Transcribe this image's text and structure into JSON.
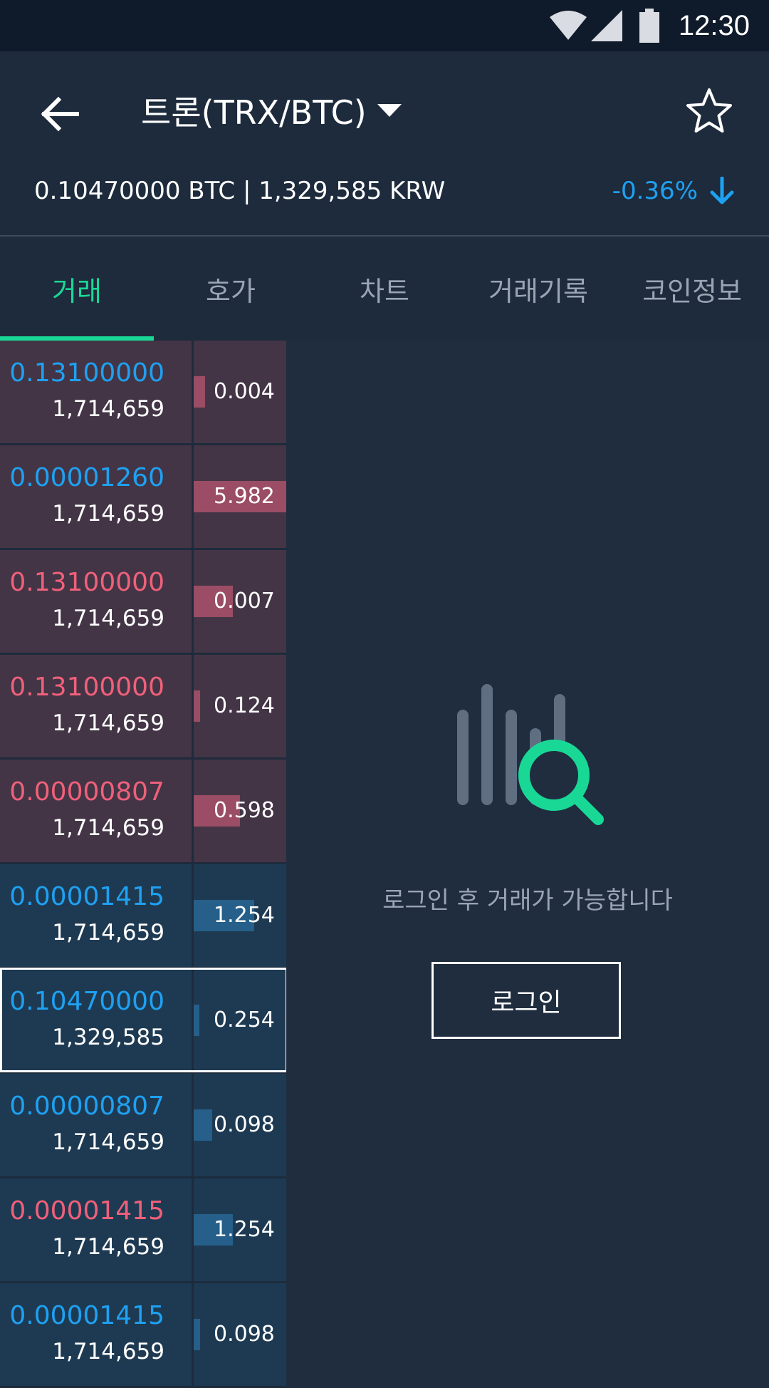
{
  "status_bar": {
    "time": "12:30",
    "icons": [
      "wifi-icon",
      "signal-icon",
      "battery-icon"
    ]
  },
  "header": {
    "back_icon": "arrow-left-icon",
    "title": "트론(TRX/BTC)",
    "dropdown_icon": "caret-down-icon",
    "favorite_icon": "star-outline-icon",
    "price_summary": "0.10470000 BTC | 1,329,585 KRW",
    "change": "-0.36%",
    "change_icon": "arrow-down-icon"
  },
  "tabs": [
    {
      "label": "거래",
      "active": true
    },
    {
      "label": "호가",
      "active": false
    },
    {
      "label": "차트",
      "active": false
    },
    {
      "label": "거래기록",
      "active": false
    },
    {
      "label": "코인정보",
      "active": false
    }
  ],
  "orderbook": {
    "rows": [
      {
        "side": "ask",
        "price": "0.13100000",
        "price_color": "blue",
        "krw": "1,714,659",
        "qty": "0.004",
        "fill": 0.12
      },
      {
        "side": "ask",
        "price": "0.00001260",
        "price_color": "blue",
        "krw": "1,714,659",
        "qty": "5.982",
        "fill": 1.0
      },
      {
        "side": "ask",
        "price": "0.13100000",
        "price_color": "red",
        "krw": "1,714,659",
        "qty": "0.007",
        "fill": 0.42
      },
      {
        "side": "ask",
        "price": "0.13100000",
        "price_color": "red",
        "krw": "1,714,659",
        "qty": "0.124",
        "fill": 0.07
      },
      {
        "side": "ask",
        "price": "0.00000807",
        "price_color": "red",
        "krw": "1,714,659",
        "qty": "0.598",
        "fill": 0.5
      },
      {
        "side": "bid",
        "price": "0.00001415",
        "price_color": "blue",
        "krw": "1,714,659",
        "qty": "1.254",
        "fill": 0.65
      },
      {
        "side": "bid",
        "price": "0.10470000",
        "price_color": "blue",
        "krw": "1,329,585",
        "qty": "0.254",
        "fill": 0.06,
        "current": true
      },
      {
        "side": "bid",
        "price": "0.00000807",
        "price_color": "blue",
        "krw": "1,714,659",
        "qty": "0.098",
        "fill": 0.2
      },
      {
        "side": "bid",
        "price": "0.00001415",
        "price_color": "red",
        "krw": "1,714,659",
        "qty": "1.254",
        "fill": 0.42
      },
      {
        "side": "bid",
        "price": "0.00001415",
        "price_color": "blue",
        "krw": "1,714,659",
        "qty": "0.098",
        "fill": 0.07
      }
    ]
  },
  "empty_state": {
    "illustration_icon": "chart-search-icon",
    "message": "로그인 후 거래가 가능합니다",
    "login_label": "로그인"
  },
  "colors": {
    "accent": "#19d896",
    "ask_row": "#433546",
    "bid_row": "#1e3a52",
    "ask_bar": "#9a4d64",
    "bid_bar": "#255f8a",
    "price_blue": "#1ea1f2",
    "price_red": "#f0607a"
  }
}
